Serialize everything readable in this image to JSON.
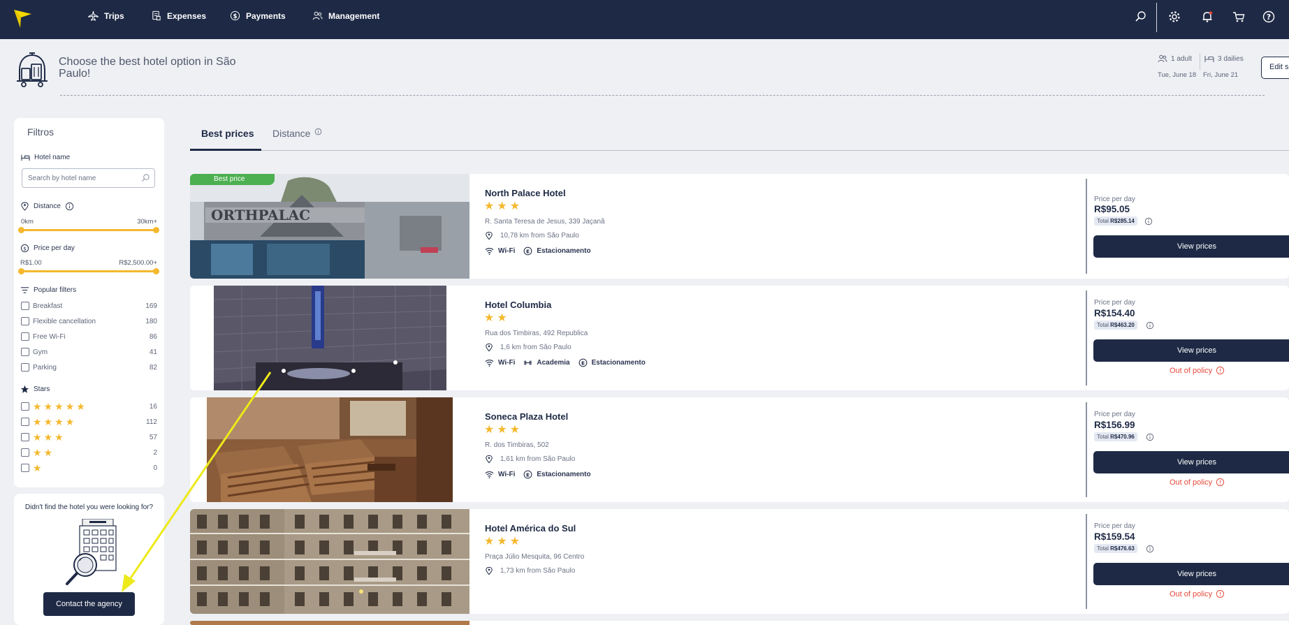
{
  "nav": {
    "items": [
      {
        "label": "Trips",
        "icon": "plane-icon"
      },
      {
        "label": "Expenses",
        "icon": "receipt-icon"
      },
      {
        "label": "Payments",
        "icon": "dollar-icon"
      },
      {
        "label": "Management",
        "icon": "users-icon"
      }
    ],
    "right_icons": [
      "search-icon",
      "gear-icon",
      "bell-icon",
      "cart-icon",
      "help-icon"
    ]
  },
  "header": {
    "title": "Choose the best hotel option in São Paulo!",
    "guests": "1 adult",
    "dailies": "3 dailies",
    "checkin": "Tue, June 18",
    "checkout": "Fri, June 21",
    "edit_button": "Edit se"
  },
  "filters": {
    "title": "Filtros",
    "hotel_name_label": "Hotel name",
    "search_placeholder": "Search by hotel name",
    "distance_label": "Distance",
    "distance_min": "0km",
    "distance_max": "30km+",
    "price_label": "Price per day",
    "price_min": "R$1.00",
    "price_max": "R$2,500.00+",
    "popular_label": "Popular filters",
    "popular": [
      {
        "label": "Breakfast",
        "count": "169"
      },
      {
        "label": "Flexible cancellation",
        "count": "180"
      },
      {
        "label": "Free Wi-Fi",
        "count": "86"
      },
      {
        "label": "Gym",
        "count": "41"
      },
      {
        "label": "Parking",
        "count": "82"
      }
    ],
    "stars_label": "Stars",
    "stars": [
      {
        "stars": 5,
        "count": "16"
      },
      {
        "stars": 4,
        "count": "112"
      },
      {
        "stars": 3,
        "count": "57"
      },
      {
        "stars": 2,
        "count": "2"
      },
      {
        "stars": 1,
        "count": "0"
      }
    ]
  },
  "help": {
    "title": "Didn't find the hotel you were looking for?",
    "button": "Contact the agency"
  },
  "tabs": [
    {
      "label": "Best prices",
      "active": true
    },
    {
      "label": "Distance",
      "active": false
    }
  ],
  "hotels": [
    {
      "badge": "Best price",
      "name": "North Palace Hotel",
      "stars": 3,
      "address": "R. Santa Teresa de Jesus, 339 Jaçanã",
      "distance": "10,78 km from São Paulo",
      "amenities": [
        {
          "label": "Wi-Fi",
          "icon": "wifi-icon"
        },
        {
          "label": "Estacionamento",
          "icon": "parking-icon"
        }
      ],
      "price_label": "Price per day",
      "price": "R$95.05",
      "total_label": "Total",
      "total": "R$285.14",
      "button": "View prices",
      "policy": ""
    },
    {
      "badge": "",
      "name": "Hotel Columbia",
      "stars": 2,
      "address": "Rua dos Timbiras, 492 Republica",
      "distance": "1,6 km from São Paulo",
      "amenities": [
        {
          "label": "Wi-Fi",
          "icon": "wifi-icon"
        },
        {
          "label": "Academia",
          "icon": "dumbbell-icon"
        },
        {
          "label": "Estacionamento",
          "icon": "parking-icon"
        }
      ],
      "price_label": "Price per day",
      "price": "R$154.40",
      "total_label": "Total",
      "total": "R$463.20",
      "button": "View prices",
      "policy": "Out of policy"
    },
    {
      "badge": "",
      "name": "Soneca Plaza Hotel",
      "stars": 3,
      "address": "R. dos Timbiras, 502",
      "distance": "1,61 km from São Paulo",
      "amenities": [
        {
          "label": "Wi-Fi",
          "icon": "wifi-icon"
        },
        {
          "label": "Estacionamento",
          "icon": "parking-icon"
        }
      ],
      "price_label": "Price per day",
      "price": "R$156.99",
      "total_label": "Total",
      "total": "R$470.96",
      "button": "View prices",
      "policy": "Out of policy"
    },
    {
      "badge": "",
      "name": "Hotel América do Sul",
      "stars": 3,
      "address": "Praça Júlio Mesquita, 96 Centro",
      "distance": "1,73 km from São Paulo",
      "amenities": [],
      "price_label": "Price per day",
      "price": "R$159.54",
      "total_label": "Total",
      "total": "R$476.63",
      "button": "View prices",
      "policy": "Out of policy"
    }
  ],
  "colors": {
    "navy": "#1e2a45",
    "accent_yellow": "#f5b82e",
    "best_price_green": "#4caf50",
    "out_of_policy_red": "#e5483a",
    "page_bg": "#eef0f4"
  }
}
